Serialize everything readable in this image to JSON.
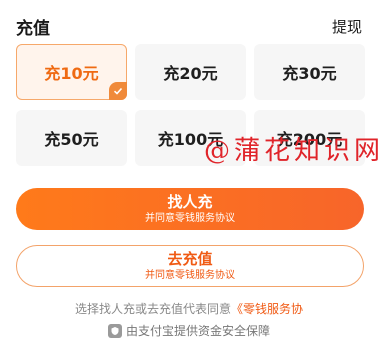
{
  "header": {
    "title": "充值",
    "withdraw_label": "提现"
  },
  "amounts": [
    {
      "label": "充10元",
      "selected": true
    },
    {
      "label": "充20元",
      "selected": false
    },
    {
      "label": "充30元",
      "selected": false
    },
    {
      "label": "充50元",
      "selected": false
    },
    {
      "label": "充100元",
      "selected": false
    },
    {
      "label": "充200元",
      "selected": false
    }
  ],
  "watermark": "@蒲花知识网",
  "buttons": {
    "find_person": {
      "label": "找人充",
      "sub": "并同意零钱服务协议"
    },
    "recharge": {
      "label": "去充值",
      "sub": "并同意零钱服务协议"
    }
  },
  "agreement": {
    "prefix": "选择找人充或去充值代表同意",
    "link": "《零钱服务协"
  },
  "footer": {
    "text": "由支付宝提供资金安全保障"
  },
  "colors": {
    "accent": "#f05a14",
    "selected_bg": "#fff4ec",
    "tile_bg": "#f6f6f6"
  }
}
